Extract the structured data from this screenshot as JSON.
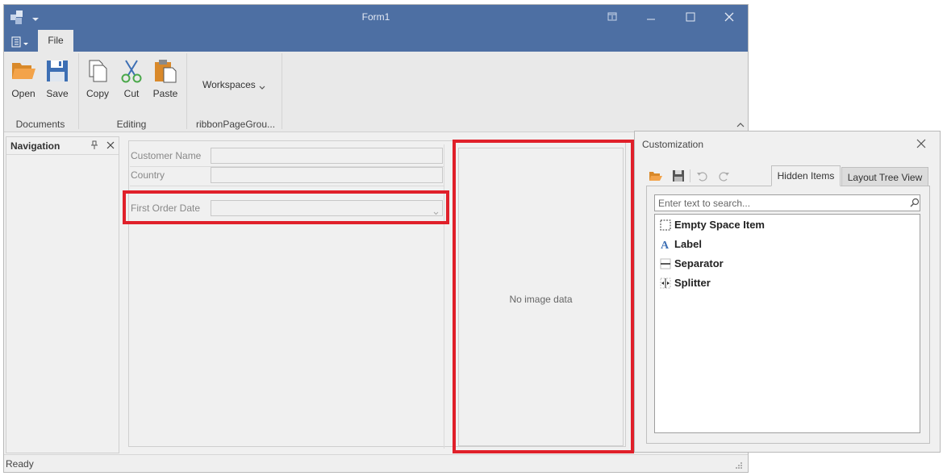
{
  "window": {
    "title": "Form1"
  },
  "ribbon": {
    "file_tab": "File",
    "groups": [
      {
        "label": "Documents",
        "buttons": [
          "Open",
          "Save"
        ]
      },
      {
        "label": "Editing",
        "buttons": [
          "Copy",
          "Cut",
          "Paste"
        ]
      },
      {
        "label": "ribbonPageGrou...",
        "buttons": [
          "Workspaces"
        ]
      }
    ]
  },
  "navigation": {
    "title": "Navigation"
  },
  "form": {
    "fields": [
      {
        "label": "Customer Name",
        "value": ""
      },
      {
        "label": "Country",
        "value": ""
      },
      {
        "label": "First Order Date",
        "value": ""
      }
    ],
    "image_placeholder": "No image data"
  },
  "status": {
    "text": "Ready"
  },
  "customization": {
    "title": "Customization",
    "tabs": [
      "Hidden Items",
      "Layout Tree View"
    ],
    "search_placeholder": "Enter text to search...",
    "items": [
      {
        "label": "Empty Space Item",
        "icon": "empty-space-icon"
      },
      {
        "label": "Label",
        "icon": "label-icon"
      },
      {
        "label": "Separator",
        "icon": "separator-icon"
      },
      {
        "label": "Splitter",
        "icon": "splitter-icon"
      }
    ]
  },
  "colors": {
    "titlebar": "#4d6fa3",
    "highlight": "#e0202a",
    "open_folder": "#f09a36",
    "save_disk": "#3d6fb4",
    "cut_green": "#4aa84a"
  }
}
